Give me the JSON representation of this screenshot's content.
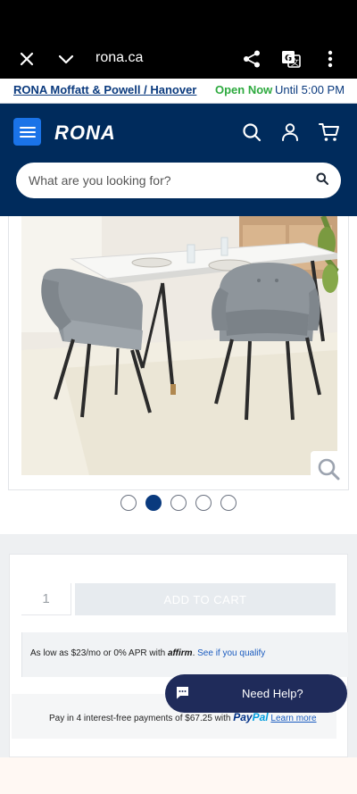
{
  "browser": {
    "url": "rona.ca",
    "icons": [
      "close-icon",
      "chevron-down-icon",
      "share-icon",
      "translate-icon",
      "more-vertical-icon"
    ]
  },
  "store_bar": {
    "store_name": "RONA Moffatt & Powell / Hanover",
    "status": "Open Now",
    "hours": "Until 5:00 PM",
    "status_color": "#2eaa3f"
  },
  "header": {
    "logo": "RONA",
    "search_placeholder": "What are you looking for?",
    "icons": [
      "menu-icon",
      "search-icon",
      "user-icon",
      "cart-icon"
    ],
    "bg_color": "#002b5c",
    "menu_button_color": "#1a73e8"
  },
  "gallery": {
    "image_description_icon": "zoom-icon",
    "dot_count": 5,
    "active_index": 1
  },
  "purchase": {
    "quantity": "1",
    "add_to_cart_label": "ADD TO CART",
    "affirm_prefix": "As low as $23/mo or 0% APR with",
    "affirm_brand": "affirm",
    "affirm_link": "See if you qualify",
    "paypal_prefix": "Pay in 4 interest-free payments of $67.25 with",
    "paypal_brand_1": "Pay",
    "paypal_brand_2": "Pal",
    "paypal_link": "Learn more"
  },
  "help": {
    "label": "Need Help?"
  }
}
